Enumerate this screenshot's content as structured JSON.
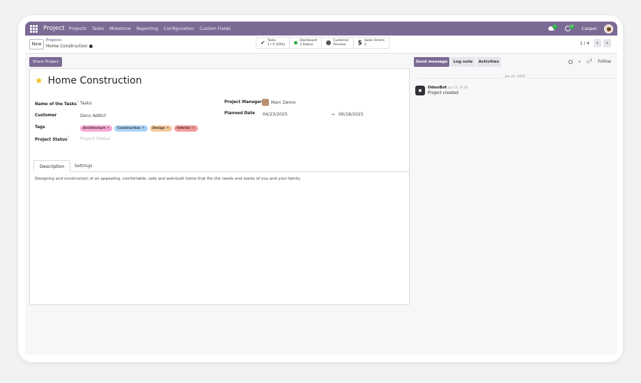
{
  "navbar": {
    "app_name": "Project",
    "menu": [
      "Projects",
      "Tasks",
      "Milestone",
      "Reporting",
      "Configuration",
      "Custom Fields"
    ],
    "messages_badge": "1",
    "activities_badge": "15",
    "user_name": "Casper"
  },
  "control": {
    "new_label": "New",
    "breadcrumb_root": "Projects",
    "breadcrumb_current": "Home Construction",
    "smart_buttons": [
      {
        "title": "Tasks",
        "value": "1 / 5 (20%)"
      },
      {
        "title": "Dashboard",
        "value": "2 Status"
      },
      {
        "title": "Customer",
        "value": "Preview"
      },
      {
        "title": "Sales Orders",
        "value": "2"
      }
    ],
    "pager": "1 / 4"
  },
  "form": {
    "share_label": "Share Project",
    "title": "Home Construction",
    "fields": {
      "tasks_label": "Name of the Tasks",
      "tasks_help": "?",
      "tasks_value": "Tasks",
      "customer_label": "Customer",
      "customer_value": "Deco Addict",
      "tags_label": "Tags",
      "status_label": "Project Status",
      "status_help": "?",
      "status_placeholder": "Project Status",
      "manager_label": "Project Manager",
      "manager_value": "Marc Demo",
      "planned_label": "Planned Date",
      "planned_start": "04/23/2025",
      "arrow": "→",
      "planned_end": "06/18/2025"
    },
    "tags": [
      {
        "label": "Architecture",
        "color": "#f7a6d3"
      },
      {
        "label": "Construction",
        "color": "#a9d2f5"
      },
      {
        "label": "Design",
        "color": "#f7c99a"
      },
      {
        "label": "Interior",
        "color": "#f59a9a"
      }
    ],
    "tabs": [
      "Description",
      "Settings"
    ],
    "description": "Designing and construction of an appealing, comfortable, safe and well-built home that fits the needs and wants of you and your family."
  },
  "chatter": {
    "send_message": "Send message",
    "log_note": "Log note",
    "activities": "Activities",
    "followers_count": "1",
    "follow": "Follow",
    "date": "Jun 23, 2025",
    "author": "OdooBot",
    "time": "Jun 23, 16:50",
    "message": "Project created"
  },
  "colors": {
    "brand": "#7a6a94",
    "success": "#28a745",
    "star": "#f3c01b"
  }
}
